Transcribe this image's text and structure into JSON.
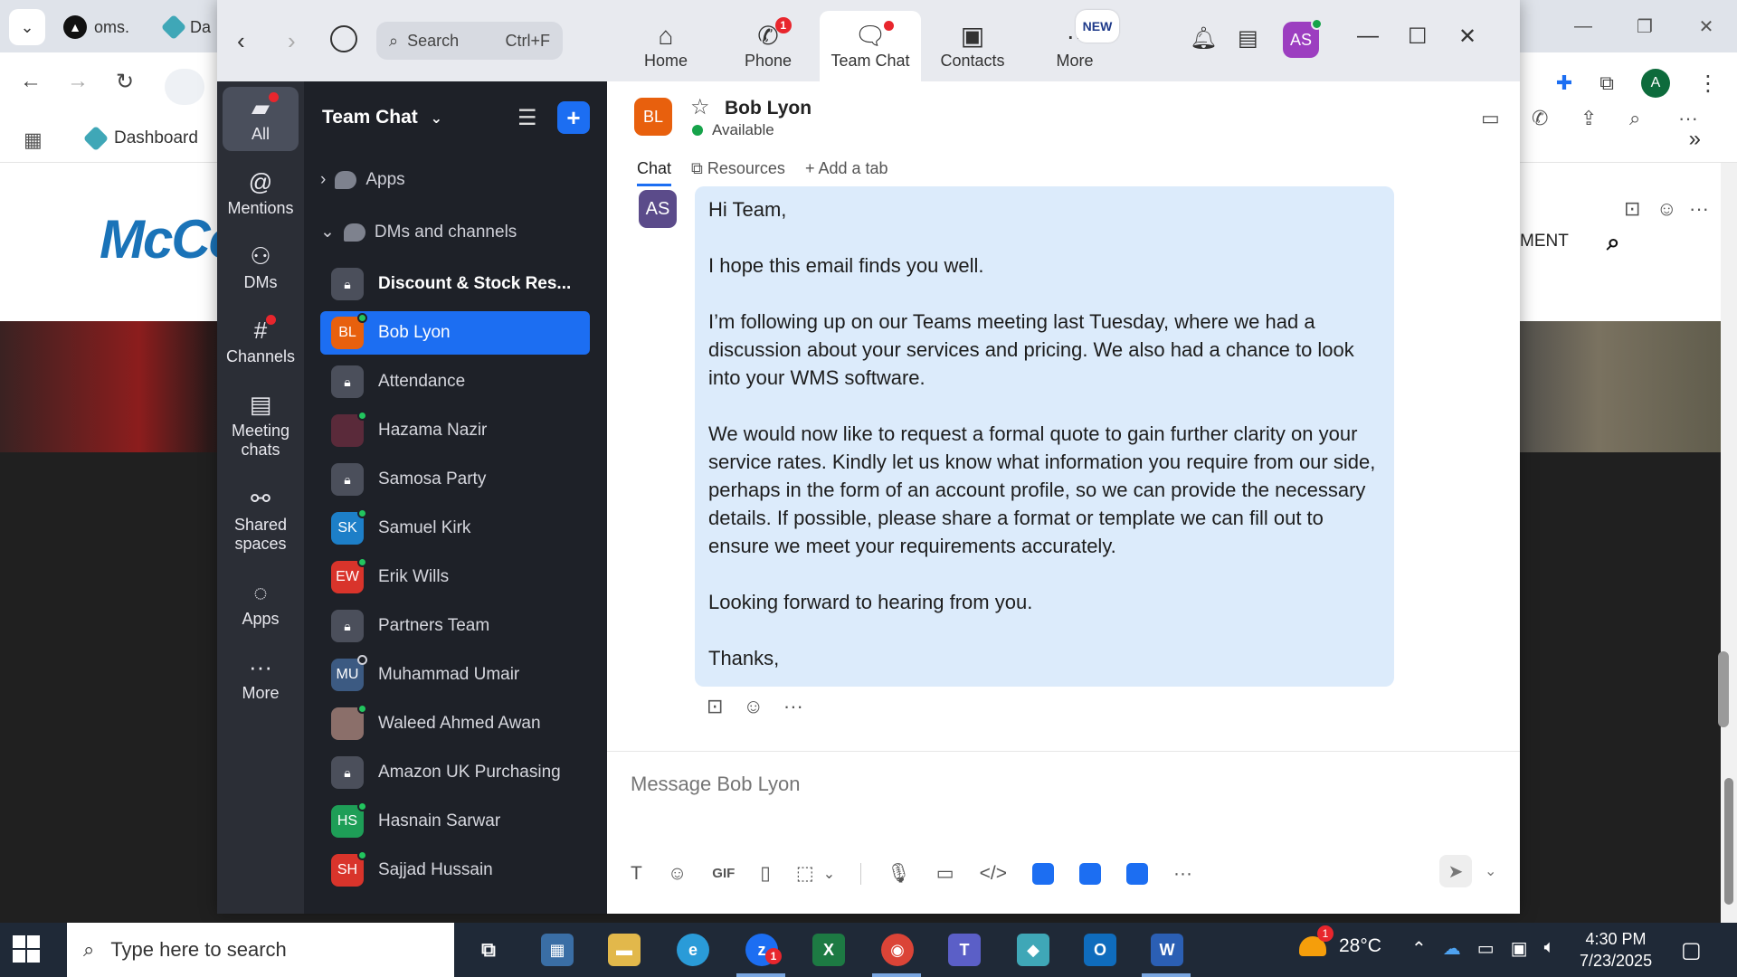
{
  "browser": {
    "tabs": [
      {
        "label": "oms."
      },
      {
        "label": "Da"
      }
    ],
    "bookmark": {
      "label": "Dashboard"
    },
    "profile_initial": "A"
  },
  "website": {
    "logo_text": "McCo",
    "menu_text": "MENT"
  },
  "zoom": {
    "search": {
      "placeholder": "Search",
      "shortcut": "Ctrl+F"
    },
    "nav_tabs": [
      {
        "label": "Home"
      },
      {
        "label": "Phone",
        "badge": "1"
      },
      {
        "label": "Team Chat"
      },
      {
        "label": "Contacts"
      },
      {
        "label": "More",
        "badge": "NEW"
      }
    ],
    "user_initials": "AS",
    "rail": [
      {
        "label": "All"
      },
      {
        "label": "Mentions"
      },
      {
        "label": "DMs"
      },
      {
        "label": "Channels"
      },
      {
        "label": "Meeting chats"
      },
      {
        "label": "Shared spaces"
      },
      {
        "label": "Apps"
      },
      {
        "label": "More"
      }
    ],
    "channel_list": {
      "title": "Team Chat",
      "sections": [
        {
          "label": "Apps"
        },
        {
          "label": "DMs and channels"
        }
      ],
      "items": [
        {
          "name": "Discount & Stock Res...",
          "initials": "",
          "avatar_color": "#4b4f5b"
        },
        {
          "name": "Bob Lyon",
          "initials": "BL",
          "avatar_color": "#e8600d"
        },
        {
          "name": "Attendance",
          "initials": "",
          "avatar_color": "#4b4f5b"
        },
        {
          "name": "Hazama Nazir",
          "initials": "",
          "avatar_color": "#5a2a3a"
        },
        {
          "name": "Samosa Party",
          "initials": "",
          "avatar_color": "#4b4f5b"
        },
        {
          "name": "Samuel Kirk",
          "initials": "SK",
          "avatar_color": "#1d7fc8"
        },
        {
          "name": "Erik Wills",
          "initials": "EW",
          "avatar_color": "#d9342b"
        },
        {
          "name": "Partners Team",
          "initials": "",
          "avatar_color": "#4b4f5b"
        },
        {
          "name": "Muhammad Umair",
          "initials": "MU",
          "avatar_color": "#3c5a82"
        },
        {
          "name": "Waleed Ahmed Awan",
          "initials": "",
          "avatar_color": "#8b6f6a"
        },
        {
          "name": "Amazon UK Purchasing",
          "initials": "",
          "avatar_color": "#4b4f5b"
        },
        {
          "name": "Hasnain Sarwar",
          "initials": "HS",
          "avatar_color": "#1e9e57"
        },
        {
          "name": "Sajjad Hussain",
          "initials": "SH",
          "avatar_color": "#d9342b"
        }
      ]
    },
    "chat": {
      "contact_initials": "BL",
      "contact_name": "Bob Lyon",
      "status": "Available",
      "tabs": [
        {
          "label": "Chat"
        },
        {
          "label": "Resources"
        },
        {
          "label": "Add a tab"
        }
      ],
      "sender_initials": "AS",
      "message_paragraphs": [
        "Hi Team,",
        "I hope this email finds you well.",
        "I’m following up on our Teams meeting last Tuesday, where we had a discussion about your services and pricing. We also had a chance to look into your WMS software.",
        "We would now like to request a formal quote to gain further clarity on your service rates. Kindly let us know what information you require from our side, perhaps in the form of an account profile, so we can provide the necessary details. If possible, please share a format or template we can fill out to ensure we meet your requirements accurately.",
        "Looking forward to hearing from you.",
        "Thanks,"
      ],
      "composer_placeholder": "Message Bob Lyon",
      "gif_label": "GIF"
    }
  },
  "taskbar": {
    "search_placeholder": "Type here to search",
    "temperature": "28°C",
    "weather_badge": "1",
    "zoom_badge": "1",
    "time": "4:30 PM",
    "date": "7/23/2025"
  }
}
